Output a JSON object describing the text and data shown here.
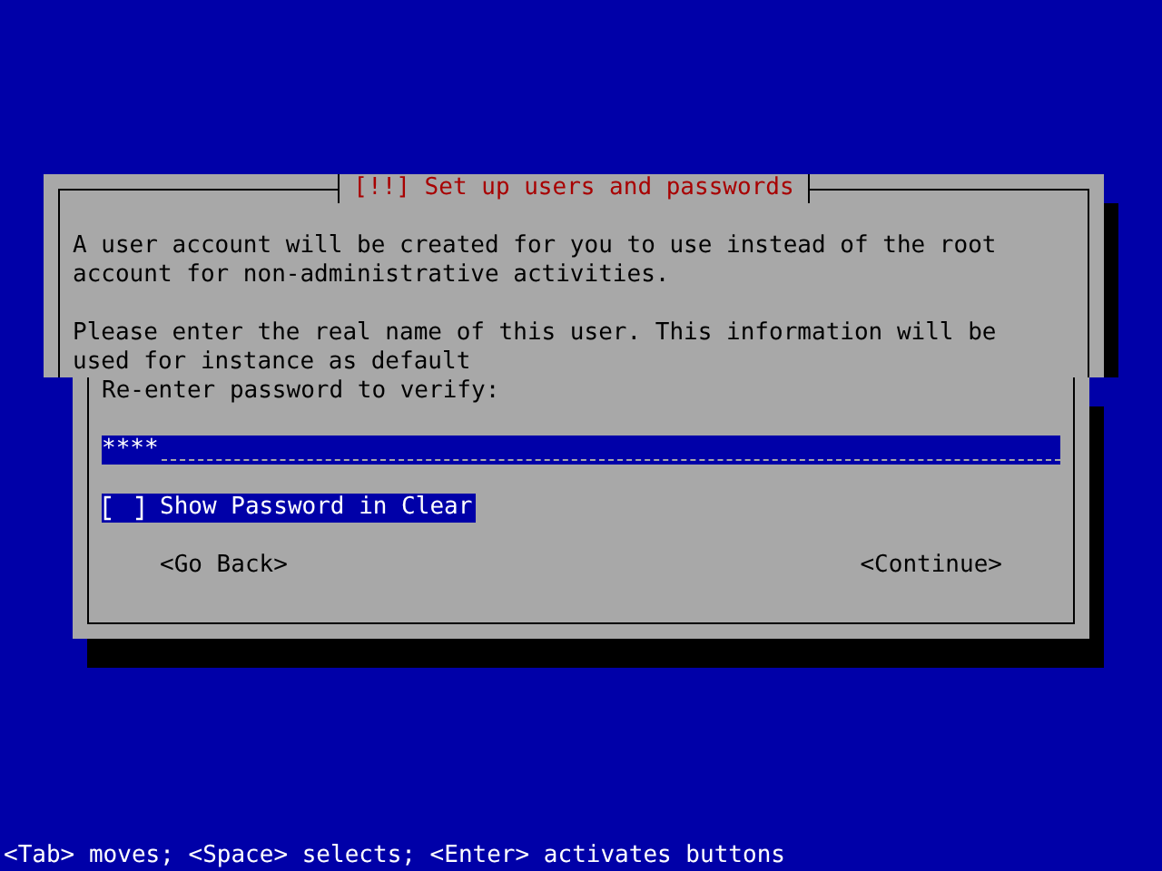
{
  "back_dialog": {
    "title": "[!!] Set up users and passwords",
    "paragraphs": [
      "A user account will be created for you to use instead of the root\naccount for non-administrative activities.",
      "Please enter the real name of this user. This information will be\nused for instance as default"
    ]
  },
  "front_dialog": {
    "prompt": "Re-enter password to verify:",
    "password_field": {
      "value": "****"
    },
    "checkbox": {
      "label": "Show Password in Clear",
      "checked": false,
      "focused": true
    },
    "buttons": [
      {
        "label": "<Go Back>",
        "selected": false
      },
      {
        "label": "<Continue>",
        "selected": false
      }
    ]
  },
  "status_bar": "<Tab> moves; <Space> selects; <Enter> activates buttons"
}
